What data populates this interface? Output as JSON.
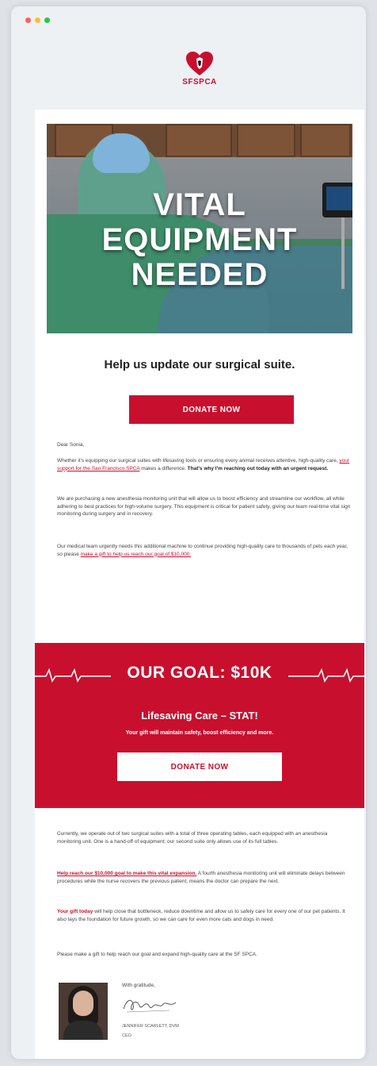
{
  "brand": {
    "logo_text": "SFSPCA",
    "accent": "#c8102e"
  },
  "hero": {
    "line1": "VITAL",
    "line2": "EQUIPMENT",
    "line3": "NEEDED"
  },
  "subhead": "Help us update our surgical suite.",
  "cta": {
    "donate_label": "DONATE NOW"
  },
  "greeting": "Dear Sonia,",
  "p1": {
    "text": "Whether it's equipping our surgical suites with lifesaving tools or ensuring every animal receives attentive, high-quality care,",
    "link": "your support for the San Francisco SPCA",
    "text2": "makes a difference.",
    "bold": "That's why I'm reaching out today with an urgent request."
  },
  "p2": "We are purchasing a new anesthesia monitoring unit that will allow us to boost efficiency and streamline our workflow, all while adhering to best practices for high-volume surgery. This equipment is critical for patient safety, giving our team real-time vital sign monitoring during surgery and in recovery.",
  "p3": {
    "text": "Our medical team urgently needs this additional machine to continue providing high-quality care to thousands of pets each year, so please",
    "link": "make a gift to help us reach our goal of $10,000."
  },
  "goal": {
    "title": "OUR GOAL: $10K",
    "subtitle": "Lifesaving Care – STAT!",
    "line": "Your gift will maintain safety, boost efficiency and more.",
    "donate_label": "DONATE NOW"
  },
  "p4": "Currently, we operate out of two surgical suites with a total of three operating tables, each equipped with an anesthesia monitoring unit. One is a hand-off of equipment; our second suite only allows use of its full tables.",
  "p5": {
    "red": "Help reach our $10,000 goal to make this vital expansion.",
    "text": "A fourth anesthesia monitoring unit will eliminate delays between procedures while the nurse recovers the previous patient, means the doctor can prepare the next."
  },
  "p6": {
    "red": "Your gift today",
    "text": "will help close that bottleneck, reduce downtime and allow us to safely care for every one of our pet patients. It also lays the foundation for future growth, so we can care for even more cats and dogs in need."
  },
  "p7": "Please make a gift to help reach our goal and expand high-quality care at the SF SPCA.",
  "signature": {
    "closing": "With gratitude,",
    "name": "JENNIFER SCARLETT, DVM",
    "title": "CEO"
  }
}
